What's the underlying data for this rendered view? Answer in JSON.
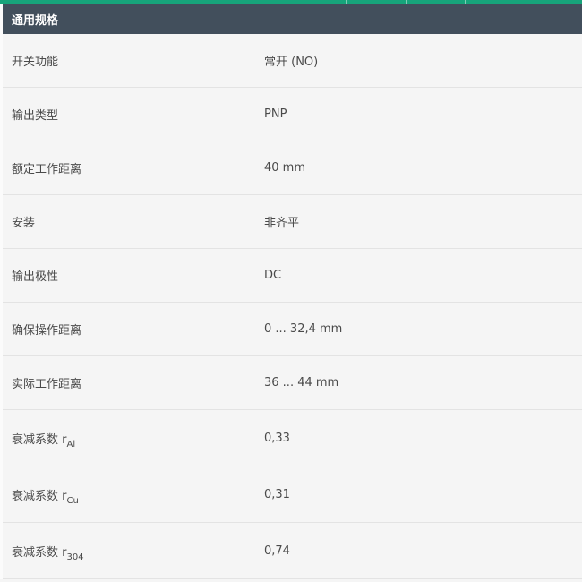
{
  "colors": {
    "accent": "#17a47b",
    "header_bg": "#424f5c"
  },
  "section": {
    "title": "通用规格",
    "rows": [
      {
        "label": "开关功能",
        "value": "常开 (NO)"
      },
      {
        "label": "输出类型",
        "value": "PNP"
      },
      {
        "label": "额定工作距离",
        "value": "40 mm"
      },
      {
        "label": "安装",
        "value": "非齐平"
      },
      {
        "label": "输出极性",
        "value": "DC"
      },
      {
        "label": "确保操作距离",
        "value": "0 ... 32,4 mm"
      },
      {
        "label": "实际工作距离",
        "value": "36 ... 44 mm"
      },
      {
        "label": "衰减系数 r",
        "label_sub": "Al",
        "value": "0,33"
      },
      {
        "label": "衰减系数 r",
        "label_sub": "Cu",
        "value": "0,31"
      },
      {
        "label": "衰减系数 r",
        "label_sub": "304",
        "value": "0,74"
      }
    ]
  }
}
